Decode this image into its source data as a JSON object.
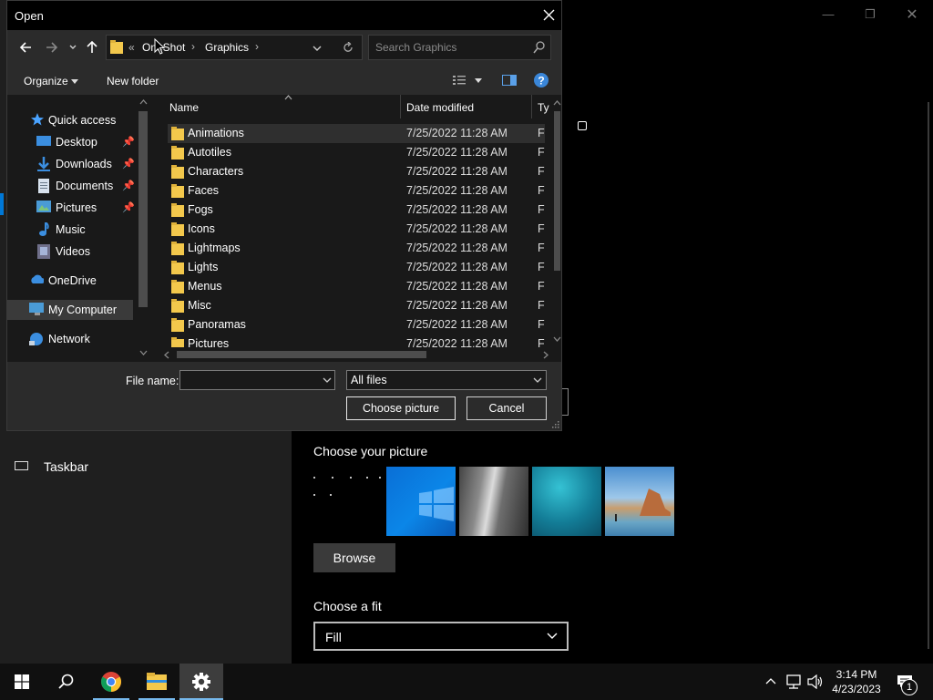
{
  "settings": {
    "sidebar_item_label": "Taskbar",
    "choose_picture_label": "Choose your picture",
    "browse_label": "Browse",
    "choose_fit_label": "Choose a fit",
    "fit_value": "Fill"
  },
  "dialog": {
    "title": "Open",
    "breadcrumb": {
      "prefix": "«",
      "items": [
        "OneShot",
        "Graphics"
      ]
    },
    "search_placeholder": "Search Graphics",
    "toolbar": {
      "organize_label": "Organize",
      "new_folder_label": "New folder"
    },
    "nav": {
      "quick_access": "Quick access",
      "items": [
        "Desktop",
        "Downloads",
        "Documents",
        "Pictures",
        "Music",
        "Videos"
      ],
      "onedrive": "OneDrive",
      "my_computer": "My Computer",
      "network": "Network"
    },
    "columns": {
      "name": "Name",
      "date": "Date modified",
      "type": "Ty"
    },
    "files": [
      {
        "name": "Animations",
        "date": "7/25/2022 11:28 AM",
        "type": "Fi"
      },
      {
        "name": "Autotiles",
        "date": "7/25/2022 11:28 AM",
        "type": "Fi"
      },
      {
        "name": "Characters",
        "date": "7/25/2022 11:28 AM",
        "type": "Fi"
      },
      {
        "name": "Faces",
        "date": "7/25/2022 11:28 AM",
        "type": "Fi"
      },
      {
        "name": "Fogs",
        "date": "7/25/2022 11:28 AM",
        "type": "Fi"
      },
      {
        "name": "Icons",
        "date": "7/25/2022 11:28 AM",
        "type": "Fi"
      },
      {
        "name": "Lightmaps",
        "date": "7/25/2022 11:28 AM",
        "type": "Fi"
      },
      {
        "name": "Lights",
        "date": "7/25/2022 11:28 AM",
        "type": "Fi"
      },
      {
        "name": "Menus",
        "date": "7/25/2022 11:28 AM",
        "type": "Fi"
      },
      {
        "name": "Misc",
        "date": "7/25/2022 11:28 AM",
        "type": "Fi"
      },
      {
        "name": "Panoramas",
        "date": "7/25/2022 11:28 AM",
        "type": "Fi"
      },
      {
        "name": "Pictures",
        "date": "7/25/2022 11:28 AM",
        "type": "Fi"
      }
    ],
    "file_name_label": "File name:",
    "file_name_value": "",
    "filter_value": "All files",
    "choose_button": "Choose picture",
    "cancel_button": "Cancel"
  },
  "taskbar": {
    "time": "3:14 PM",
    "date": "4/23/2023",
    "notification_count": "1"
  },
  "colors": {
    "accent": "#0078d7",
    "folder": "#f3c84c",
    "help": "#3a86d8"
  }
}
